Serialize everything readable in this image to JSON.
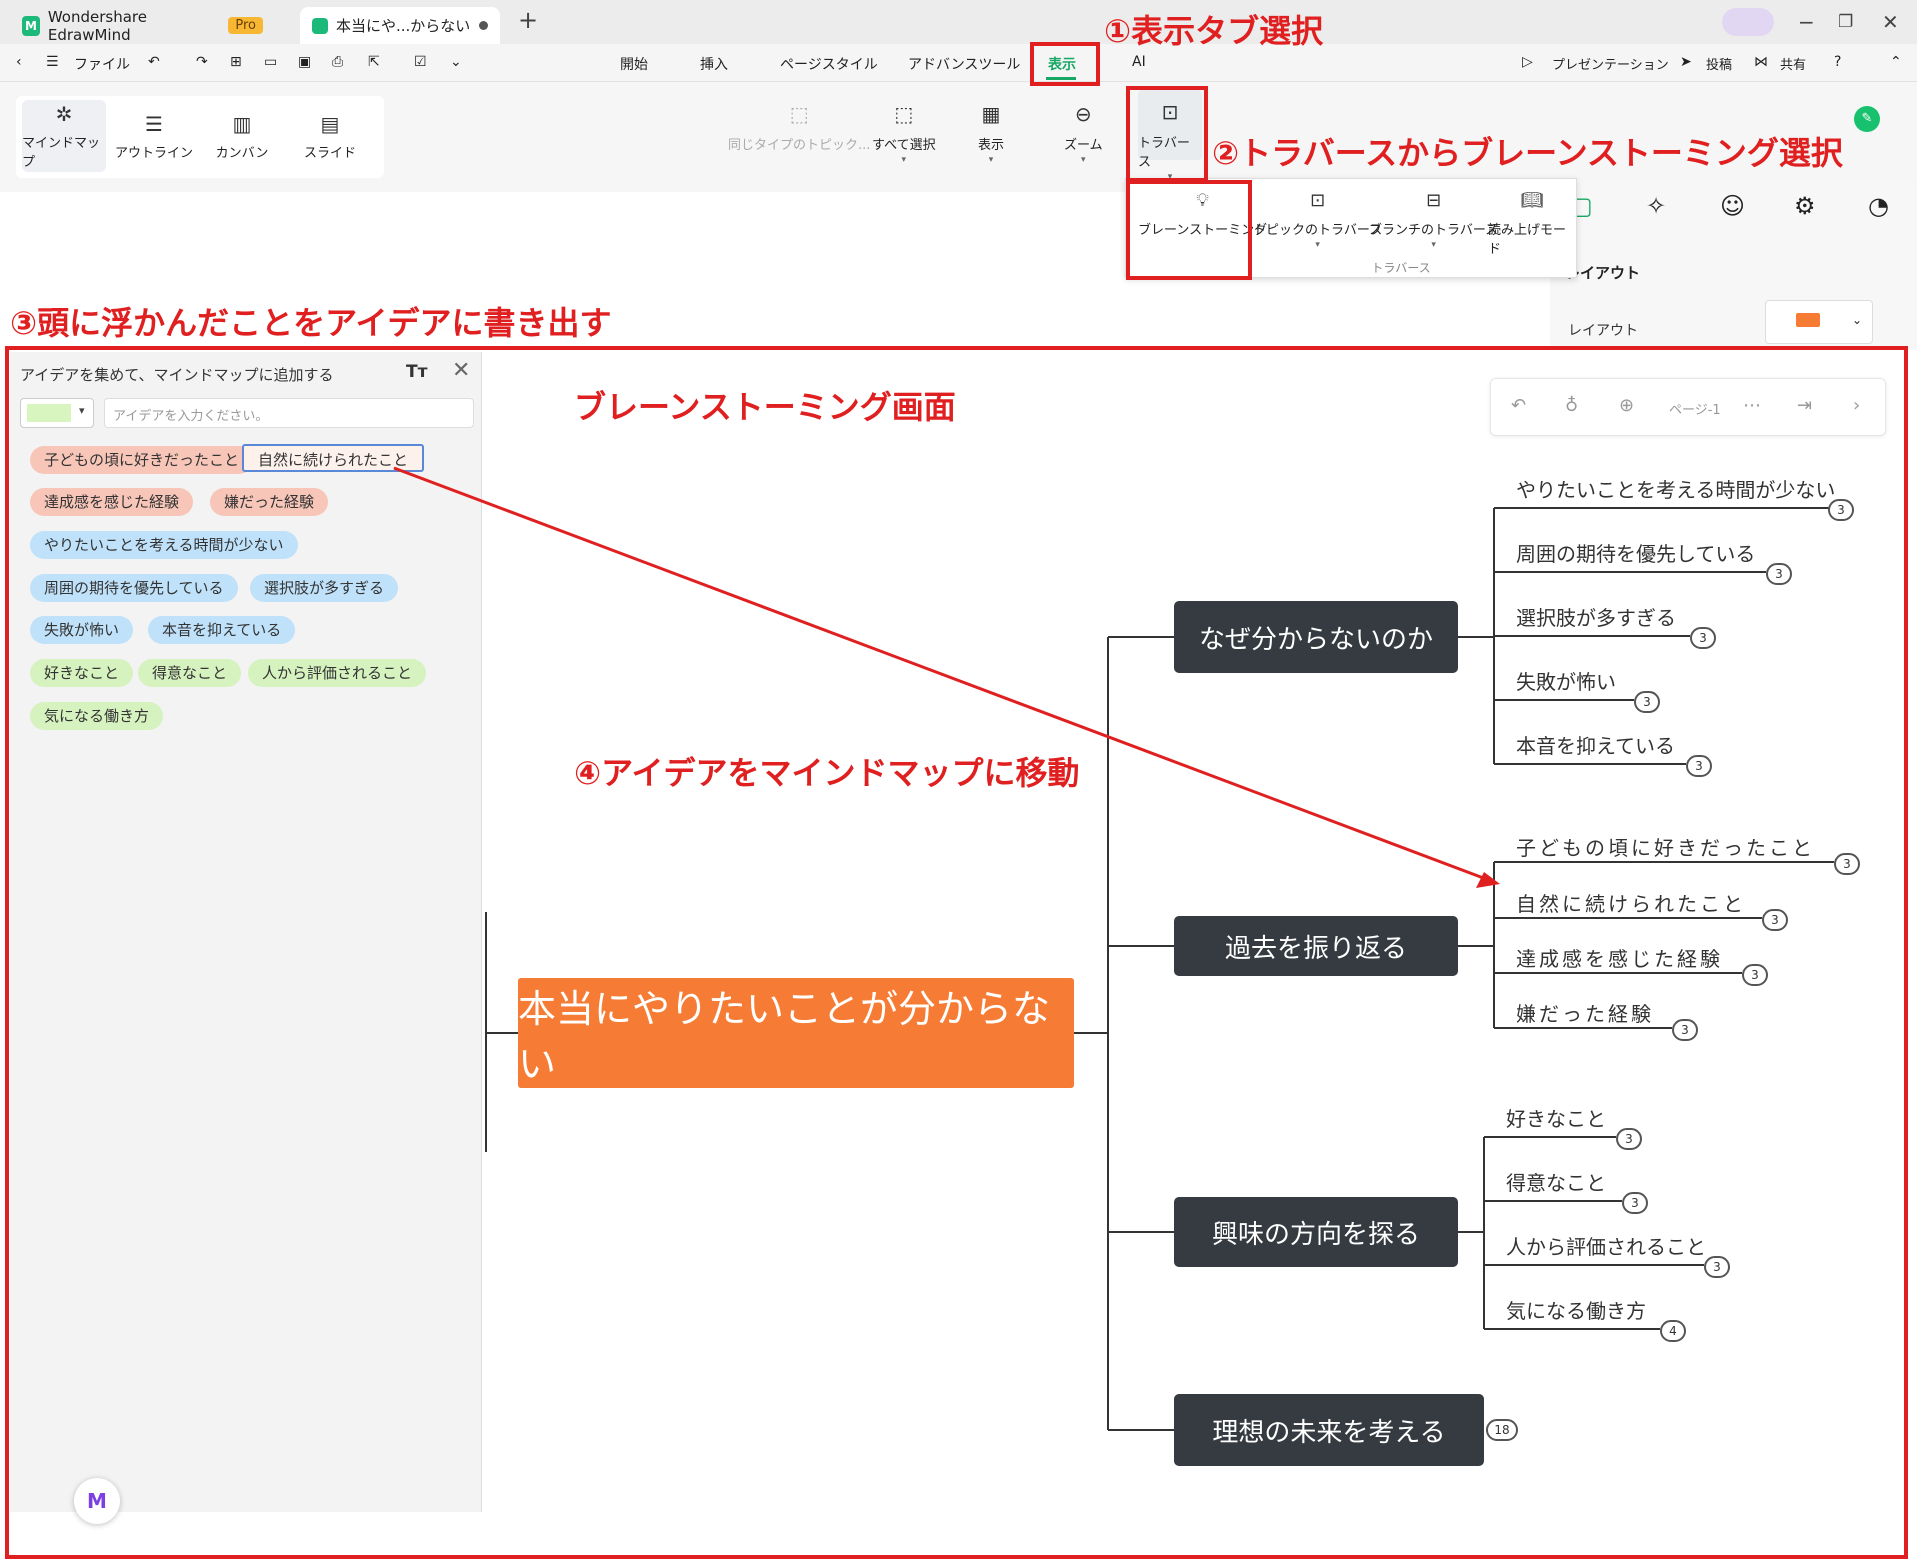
{
  "titlebar": {
    "app_name": "Wondershare EdrawMind",
    "pro_badge": "Pro",
    "doc_tab": "本当にや...からない",
    "new_tab": "+"
  },
  "menubar": {
    "file": "ファイル",
    "tabs": [
      "開始",
      "挿入",
      "ページスタイル",
      "アドバンスツール",
      "表示",
      "AI"
    ],
    "active_tab": "表示",
    "right": {
      "present": "プレゼンテーション",
      "post": "投稿",
      "share": "共有"
    }
  },
  "ribbon": {
    "views": [
      "マインドマップ",
      "アウトライン",
      "カンバン",
      "スライド"
    ],
    "tools": [
      "同じタイプのトピック...",
      "すべて選択",
      "表示",
      "ズーム",
      "トラバース"
    ]
  },
  "dropdown": {
    "items": [
      "ブレーンストーミング",
      "トピックのトラバース",
      "ブランチのトラバース",
      "読み上げモード"
    ],
    "footer": "トラバース"
  },
  "right_panel": {
    "heading": "レイアウト",
    "label": "レイアウト"
  },
  "annotations": {
    "step1": "①表示タブ選択",
    "step2": "②トラバースからブレーンストーミング選択",
    "step3": "③頭に浮かんだことをアイデアに書き出す",
    "step4": "④アイデアをマインドマップに移動",
    "screen_label": "ブレーンストーミング画面"
  },
  "idea_panel": {
    "title": "アイデアを集めて、マインドマップに追加する",
    "font_btn": "Tт",
    "placeholder": "アイデアを入力ください。",
    "chips": [
      {
        "text": "子どもの頃に好きだったこと",
        "color": "#f7c6b9"
      },
      {
        "text": "自然に続けられたこと",
        "color": "#fdf1ec"
      },
      {
        "text": "達成感を感じた経験",
        "color": "#f7c6b9"
      },
      {
        "text": "嫌だった経験",
        "color": "#f7c6b9"
      },
      {
        "text": "やりたいことを考える時間が少ない",
        "color": "#bfe2fa"
      },
      {
        "text": "周囲の期待を優先している",
        "color": "#bfe2fa"
      },
      {
        "text": "選択肢が多すぎる",
        "color": "#bfe2fa"
      },
      {
        "text": "失敗が怖い",
        "color": "#bfe2fa"
      },
      {
        "text": "本音を抑えている",
        "color": "#bfe2fa"
      },
      {
        "text": "好きなこと",
        "color": "#d5f2bf"
      },
      {
        "text": "得意なこと",
        "color": "#d5f2bf"
      },
      {
        "text": "人から評価されること",
        "color": "#d5f2bf"
      },
      {
        "text": "気になる働き方",
        "color": "#d5f2bf"
      }
    ]
  },
  "canvas_toolbar": {
    "page": "ページ-1"
  },
  "mindmap": {
    "central": "本当にやりたいことが分からない",
    "central_color": "#f67c35",
    "branches": [
      {
        "title": "なぜ分からないのか",
        "leaves": [
          {
            "text": "やりたいことを考える時間が少ない",
            "count": "3"
          },
          {
            "text": "周囲の期待を優先している",
            "count": "3"
          },
          {
            "text": "選択肢が多すぎる",
            "count": "3"
          },
          {
            "text": "失敗が怖い",
            "count": "3"
          },
          {
            "text": "本音を抑えている",
            "count": "3"
          }
        ]
      },
      {
        "title": "過去を振り返る",
        "leaves": [
          {
            "text": "子どもの頃に好きだったこと",
            "count": "3"
          },
          {
            "text": "自然に続けられたこと",
            "count": "3"
          },
          {
            "text": "達成感を感じた経験",
            "count": "3"
          },
          {
            "text": "嫌だった経験",
            "count": "3"
          }
        ]
      },
      {
        "title": "興味の方向を探る",
        "leaves": [
          {
            "text": "好きなこと",
            "count": "3"
          },
          {
            "text": "得意なこと",
            "count": "3"
          },
          {
            "text": "人から評価されること",
            "count": "3"
          },
          {
            "text": "気になる働き方",
            "count": "4"
          }
        ]
      },
      {
        "title": "理想の未来を考える",
        "count": "18",
        "leaves": []
      }
    ]
  },
  "colors": {
    "annotation": "#e02020",
    "branch": "#353b40",
    "accent": "#18a865"
  }
}
